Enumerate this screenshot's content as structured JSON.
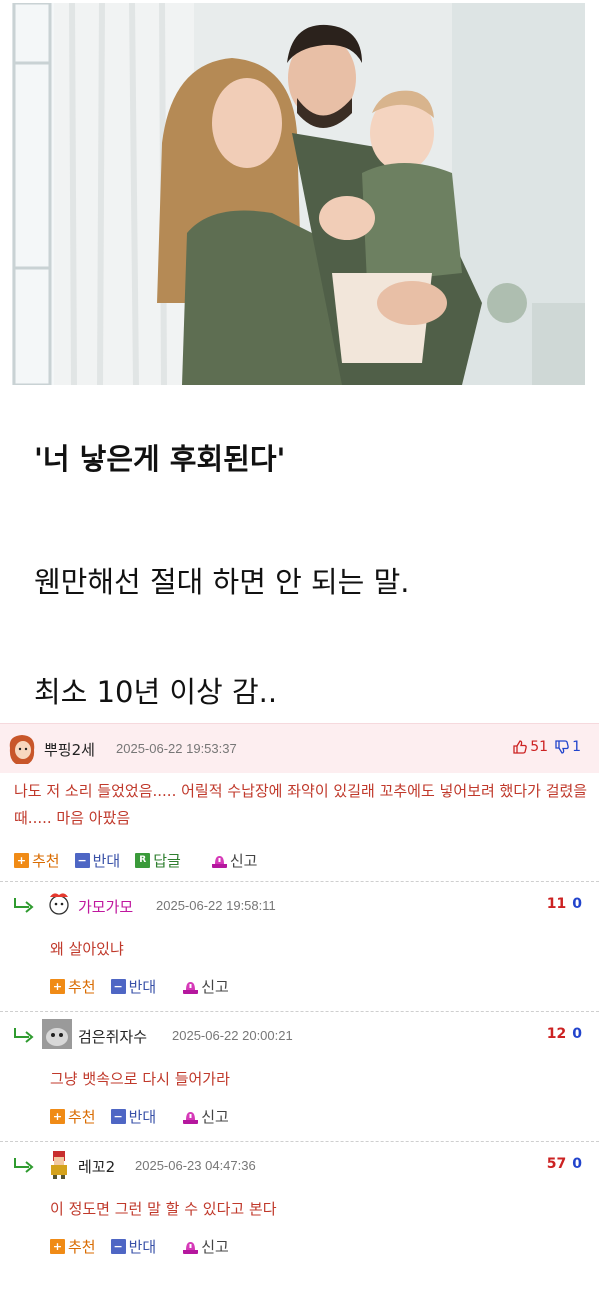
{
  "article": {
    "title": "'너 낳은게 후회된다'",
    "body_line1": "웬만해선 절대 하면 안 되는 말.",
    "body_line2": "최소 10년 이상 감.."
  },
  "best_comment": {
    "nickname": "뿌핑2세",
    "datetime": "2025-06-22 19:53:37",
    "upvotes": "51",
    "downvotes": "1",
    "text": "나도 저 소리 들었었음..... 어릴적 수납장에 좌약이 있길래 꼬추에도 넣어보려 했다가 걸렸을때..... 마음 아팠음",
    "actions": {
      "recommend": "추천",
      "oppose": "반대",
      "reply": "답글",
      "report": "신고"
    }
  },
  "replies": [
    {
      "nickname": "가모가모",
      "datetime": "2025-06-22 19:58:11",
      "upvotes": "11",
      "downvotes": "0",
      "text": "왜 살아있냐",
      "recommend": "추천",
      "oppose": "반대",
      "report": "신고"
    },
    {
      "nickname": "검은쥐자수",
      "datetime": "2025-06-22 20:00:21",
      "upvotes": "12",
      "downvotes": "0",
      "text": "그냥 뱃속으로 다시 들어가라",
      "recommend": "추천",
      "oppose": "반대",
      "report": "신고"
    },
    {
      "nickname": "레꼬2",
      "datetime": "2025-06-23 04:47:36",
      "upvotes": "57",
      "downvotes": "0",
      "text": "이 정도면 그런 말 할 수 있다고 본다",
      "recommend": "추천",
      "oppose": "반대",
      "report": "신고"
    }
  ],
  "colors": {
    "best_bg": "#fdeef0",
    "comment_text": "#c0392b",
    "upvote": "#cc2222",
    "downvote": "#2244cc"
  },
  "icons": [
    "thumb-up-icon",
    "thumb-down-icon",
    "reply-arrow-icon",
    "plus-icon",
    "minus-icon",
    "reply-r-icon",
    "report-icon",
    "avatar"
  ]
}
